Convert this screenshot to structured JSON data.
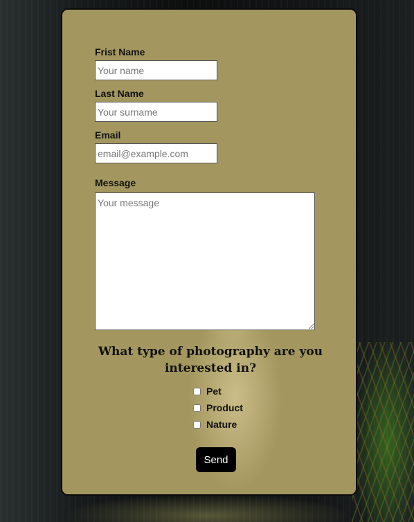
{
  "form": {
    "first_name": {
      "label": "Frist Name",
      "placeholder": "Your name"
    },
    "last_name": {
      "label": "Last Name",
      "placeholder": "Your surname"
    },
    "email": {
      "label": "Email",
      "placeholder": "email@example.com"
    },
    "message": {
      "label": "Message",
      "placeholder": "Your message"
    },
    "question": "What type of photography are you interested in?",
    "options": [
      {
        "label": "Pet",
        "checked": false
      },
      {
        "label": "Product",
        "checked": false
      },
      {
        "label": "Nature",
        "checked": false
      }
    ],
    "send_label": "Send"
  },
  "colors": {
    "card_background": "#a3975f",
    "button_background": "#000000",
    "button_text": "#ffffff"
  }
}
